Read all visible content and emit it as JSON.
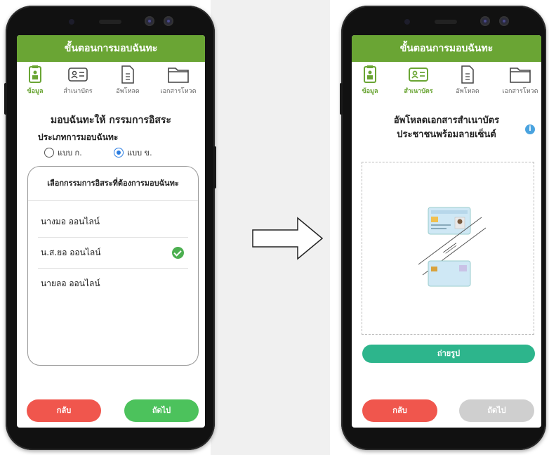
{
  "left_screen": {
    "title": "ขั้นตอนการมอบฉันทะ",
    "steps": [
      {
        "label": "ข้อมูล",
        "icon": "clipboard-icon",
        "active": true
      },
      {
        "label": "สำเนาบัตร",
        "icon": "id-card-icon",
        "active": false
      },
      {
        "label": "อัพโหลด",
        "icon": "document-icon",
        "active": false
      },
      {
        "label": "เอกสารโหวต",
        "icon": "folder-icon",
        "active": false
      }
    ],
    "heading": "มอบฉันทะให้ กรรมการอิสระ",
    "proxy_type_label": "ประเภทการมอบฉันทะ",
    "radio_options": [
      {
        "label": "แบบ ก.",
        "selected": false
      },
      {
        "label": "แบบ ข.",
        "selected": true
      }
    ],
    "card_title": "เลือกกรรมการอิสระที่ต้องการมอบฉันทะ",
    "directors": [
      {
        "name": "นางมอ  ออนไลน์",
        "selected": false
      },
      {
        "name": "น.ส.ยอ  ออนไลน์",
        "selected": true
      },
      {
        "name": "นายลอ  ออนไลน์",
        "selected": false
      }
    ],
    "back_label": "กลับ",
    "next_label": "ถัดไป"
  },
  "right_screen": {
    "title": "ขั้นตอนการมอบฉันทะ",
    "steps": [
      {
        "label": "ข้อมูล",
        "icon": "clipboard-icon",
        "active": true
      },
      {
        "label": "สำเนาบัตร",
        "icon": "id-card-icon",
        "active": true
      },
      {
        "label": "อัพโหลด",
        "icon": "document-icon",
        "active": false
      },
      {
        "label": "เอกสารโหวต",
        "icon": "folder-icon",
        "active": false
      }
    ],
    "heading_line1": "อัพโหลดเอกสารสำเนาบัตร",
    "heading_line2": "ประชาชนพร้อมลายเซ็นต์",
    "info_icon": "i",
    "take_photo_label": "ถ่ายรูป",
    "back_label": "กลับ",
    "next_label": "ถัดไป"
  },
  "colors": {
    "brand_green": "#6aa534",
    "back_red": "#f0564d",
    "next_green": "#4cc25c",
    "photo_teal": "#2db58c",
    "disabled_gray": "#cfcfcf"
  }
}
